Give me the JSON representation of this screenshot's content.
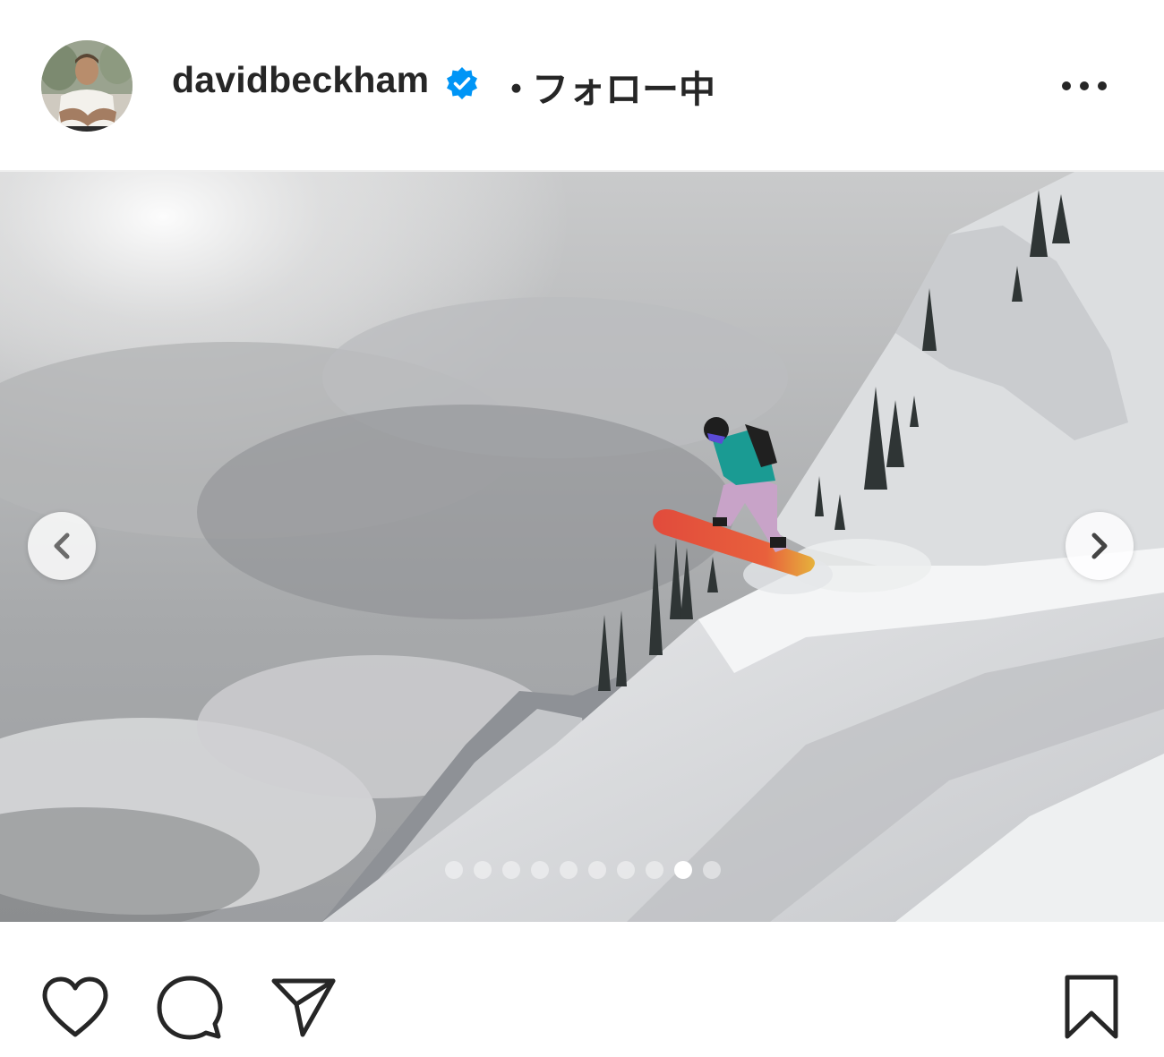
{
  "post": {
    "username": "davidbeckham",
    "separator": "・",
    "follow_status": "フォロー中",
    "verified": true
  },
  "header": {
    "more_icon": "more-horizontal-icon",
    "avatar_alt": "davidbeckham"
  },
  "media": {
    "description_icon": "photo",
    "carousel": {
      "total_slides": 10,
      "current_slide": 9
    },
    "prev_icon": "chevron-left-icon",
    "next_icon": "chevron-right-icon"
  },
  "actions": {
    "like_icon": "heart-icon",
    "comment_icon": "comment-icon",
    "share_icon": "paper-plane-icon",
    "save_icon": "bookmark-icon"
  },
  "colors": {
    "text": "#262626",
    "verified_blue": "#0095f6",
    "divider": "#efefef"
  }
}
